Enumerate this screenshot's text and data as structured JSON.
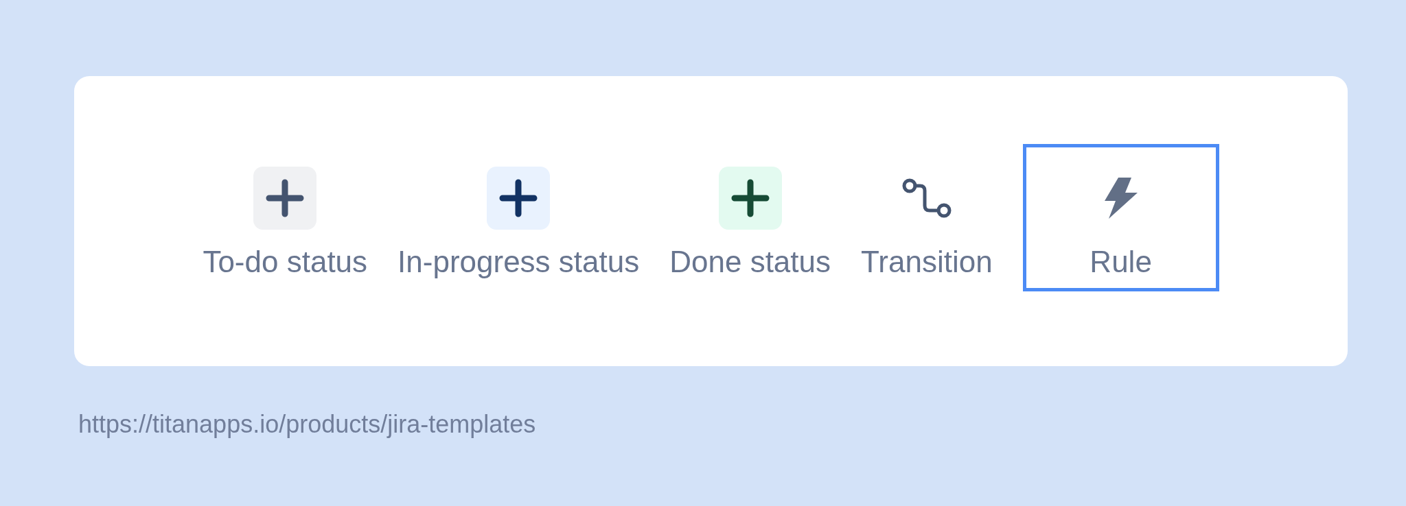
{
  "palette": {
    "items": [
      {
        "kind": "todo",
        "label": "To-do status",
        "selected": false
      },
      {
        "kind": "progress",
        "label": "In-progress status",
        "selected": false
      },
      {
        "kind": "done",
        "label": "Done status",
        "selected": false
      },
      {
        "kind": "transition",
        "label": "Transition",
        "selected": false
      },
      {
        "kind": "rule",
        "label": "Rule",
        "selected": true
      }
    ]
  },
  "caption": {
    "url": "https://titanapps.io/products/jira-templates"
  }
}
